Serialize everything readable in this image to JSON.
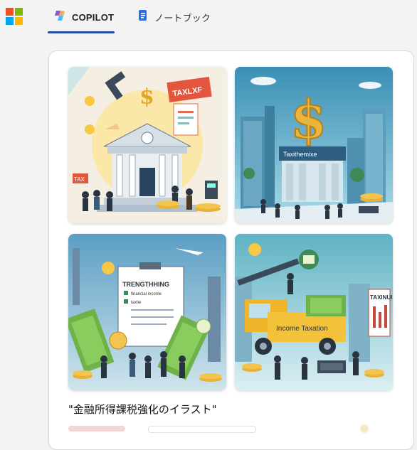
{
  "header": {
    "tabs": [
      {
        "label": "COPILOT",
        "icon": "copilot-icon",
        "active": true
      },
      {
        "label": "ノートブック",
        "icon": "notebook-icon",
        "active": false
      }
    ]
  },
  "images": [
    {
      "name": "image-1",
      "sign_text": "TAXLXF",
      "side_sign": "TAX"
    },
    {
      "name": "image-2",
      "building_text": "Taxithemixe"
    },
    {
      "name": "image-3",
      "doc_title": "TRENGTHHING",
      "doc_lines": [
        "financial income",
        "taxtie"
      ]
    },
    {
      "name": "image-4",
      "truck_text": "Income Taxation",
      "doc_title": "TAXINUI"
    }
  ],
  "caption": "\"金融所得課税強化のイラスト\"",
  "colors": {
    "accent_underline": "#1f4aa8",
    "ms_red": "#f25022",
    "ms_green": "#7fba00",
    "ms_blue": "#00a4ef",
    "ms_yellow": "#ffb900"
  }
}
